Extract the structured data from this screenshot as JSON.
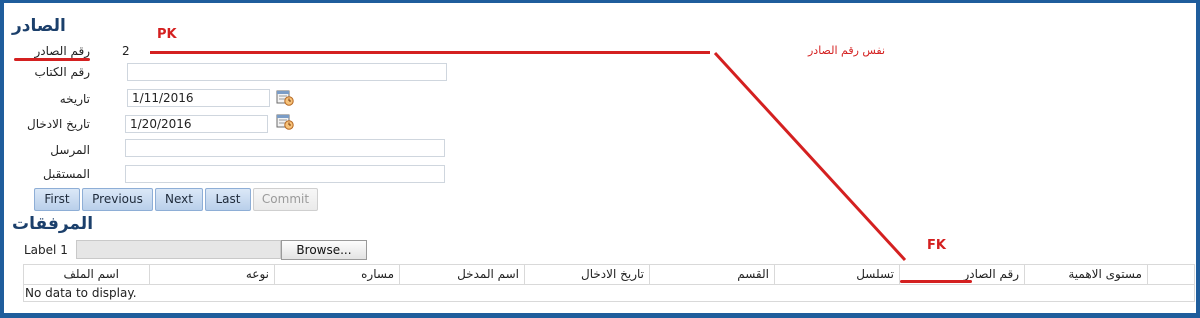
{
  "sections": {
    "outgoing_title": "الصادر",
    "attachments_title": "المرفقات"
  },
  "form": {
    "outgoing_number": {
      "label": "رقم الصادر",
      "value": "2"
    },
    "book_number": {
      "label": "رقم الكتاب",
      "value": ""
    },
    "date": {
      "label": "تاريخه",
      "value": "1/11/2016"
    },
    "entry_date": {
      "label": "تاريخ الادخال",
      "value": "1/20/2016"
    },
    "sender": {
      "label": "المرسل",
      "value": ""
    },
    "receiver": {
      "label": "المستقبل",
      "value": ""
    }
  },
  "nav_buttons": {
    "first": "First",
    "previous": "Previous",
    "next": "Next",
    "last": "Last",
    "commit": "Commit"
  },
  "attachments": {
    "file_label": "Label 1",
    "browse": "Browse...",
    "columns": [
      "اسم الملف",
      "نوعه",
      "مساره",
      "اسم المدخل",
      "تاريخ الادخال",
      "القسم",
      "تسلسل",
      "رقم الصادر",
      "مستوى الاهمية"
    ],
    "empty_text": "No data to display."
  },
  "annotations": {
    "pk": "PK",
    "fk": "FK",
    "note": "نفس رقم الصادر",
    "color": "#d42020"
  },
  "colors": {
    "frame": "#1f5d9c",
    "title": "#1b3f6b",
    "button": "#b9cfea"
  }
}
